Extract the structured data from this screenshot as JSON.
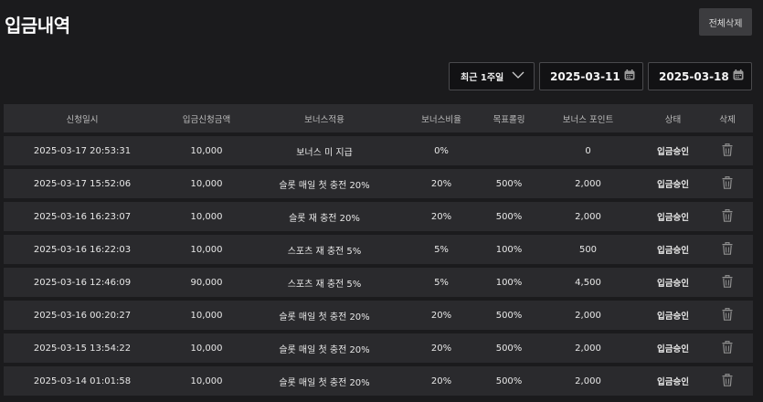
{
  "header": {
    "title": "입금내역",
    "delete_all_label": "전체삭제"
  },
  "filters": {
    "period": "최근 1주일",
    "start_date": "2025-03-11",
    "end_date": "2025-03-18"
  },
  "table": {
    "columns": [
      "신청일시",
      "입금신청금액",
      "보너스적용",
      "보너스비율",
      "목표롤링",
      "보너스 포인트",
      "상태",
      "삭제"
    ],
    "rows": [
      {
        "datetime": "2025-03-17 20:53:31",
        "amount": "10,000",
        "bonus": "보너스 미 지급",
        "ratio": "0%",
        "rolling": "",
        "points": "0",
        "status": "입금승인"
      },
      {
        "datetime": "2025-03-17 15:52:06",
        "amount": "10,000",
        "bonus": "슬롯 매일 첫 충전 20%",
        "ratio": "20%",
        "rolling": "500%",
        "points": "2,000",
        "status": "입금승인"
      },
      {
        "datetime": "2025-03-16 16:23:07",
        "amount": "10,000",
        "bonus": "슬롯 재 충전 20%",
        "ratio": "20%",
        "rolling": "500%",
        "points": "2,000",
        "status": "입금승인"
      },
      {
        "datetime": "2025-03-16 16:22:03",
        "amount": "10,000",
        "bonus": "스포츠 재 충전 5%",
        "ratio": "5%",
        "rolling": "100%",
        "points": "500",
        "status": "입금승인"
      },
      {
        "datetime": "2025-03-16 12:46:09",
        "amount": "90,000",
        "bonus": "스포츠 재 충전 5%",
        "ratio": "5%",
        "rolling": "100%",
        "points": "4,500",
        "status": "입금승인"
      },
      {
        "datetime": "2025-03-16 00:20:27",
        "amount": "10,000",
        "bonus": "슬롯 매일 첫 충전 20%",
        "ratio": "20%",
        "rolling": "500%",
        "points": "2,000",
        "status": "입금승인"
      },
      {
        "datetime": "2025-03-15 13:54:22",
        "amount": "10,000",
        "bonus": "슬롯 매일 첫 충전 20%",
        "ratio": "20%",
        "rolling": "500%",
        "points": "2,000",
        "status": "입금승인"
      },
      {
        "datetime": "2025-03-14 01:01:58",
        "amount": "10,000",
        "bonus": "슬롯 매일 첫 충전 20%",
        "ratio": "20%",
        "rolling": "500%",
        "points": "2,000",
        "status": "입금승인"
      }
    ]
  },
  "icons": {
    "period_toggle": "chevron-down-icon",
    "date_picker": "calendar-icon",
    "row_delete": "trash-icon"
  },
  "colors": {
    "background": "#1b1b1d",
    "row": "#2a2a2d",
    "header_row": "#2c2c2f",
    "input_bg": "#121214",
    "button_bg": "#3c3c3f"
  }
}
